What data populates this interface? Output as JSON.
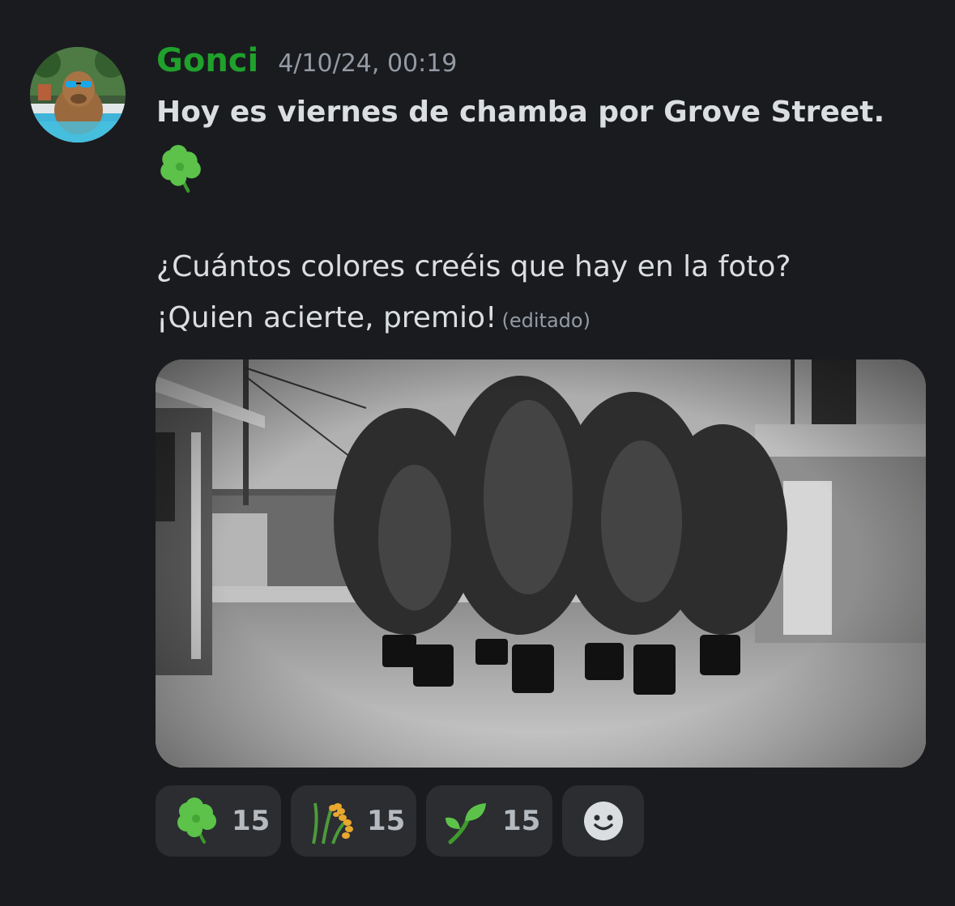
{
  "message": {
    "author": "Gonci",
    "timestamp": "4/10/24, 00:19",
    "author_color": "#1fa12b",
    "line_bold": "Hoy es viernes de chamba por Grove Street.",
    "line_bold_emoji": "shamrock",
    "line1": "¿Cuántos colores creéis que hay en la foto?",
    "line2": "¡Quien acierte, premio!",
    "edited_label": "(editado)"
  },
  "attachment": {
    "type": "image",
    "subject": "black-and-white-photo-potted-plants-backyard"
  },
  "reactions": [
    {
      "emoji": "shamrock",
      "count": "15"
    },
    {
      "emoji": "sheaf-of-rice",
      "count": "15"
    },
    {
      "emoji": "seedling",
      "count": "15"
    }
  ],
  "add_reaction": {
    "icon": "smiley-add-reaction-icon"
  },
  "colors": {
    "background": "#1a1b1f",
    "text": "#dbdee1",
    "muted": "#949ba4",
    "reaction_bg": "#2b2d31"
  }
}
